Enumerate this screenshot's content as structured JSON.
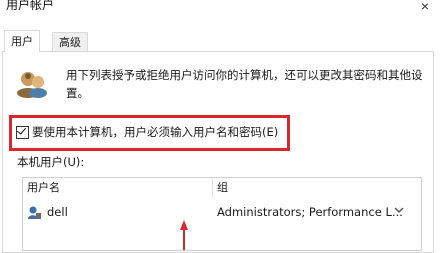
{
  "window": {
    "title": "用户帐户",
    "close_glyph": "×"
  },
  "tabs": [
    {
      "label": "用户",
      "active": true
    },
    {
      "label": "高级",
      "active": false
    }
  ],
  "description": "用下列表授予或拒绝用户访问你的计算机，还可以更改其密码和其他设置。",
  "checkbox": {
    "label": "要使用本计算机，用户必须输入用户名和密码(E)",
    "checked": true
  },
  "users_list": {
    "label": "本机用户(U):",
    "columns": [
      "用户名",
      "组"
    ],
    "rows": [
      {
        "name": "dell",
        "group": "Administrators; Performance L..."
      }
    ]
  },
  "icons": [
    "users-icon",
    "user-icon",
    "close-icon",
    "checkmark-icon"
  ],
  "colors": {
    "annotation": "#d8282f",
    "border": "#d9d9d9"
  }
}
